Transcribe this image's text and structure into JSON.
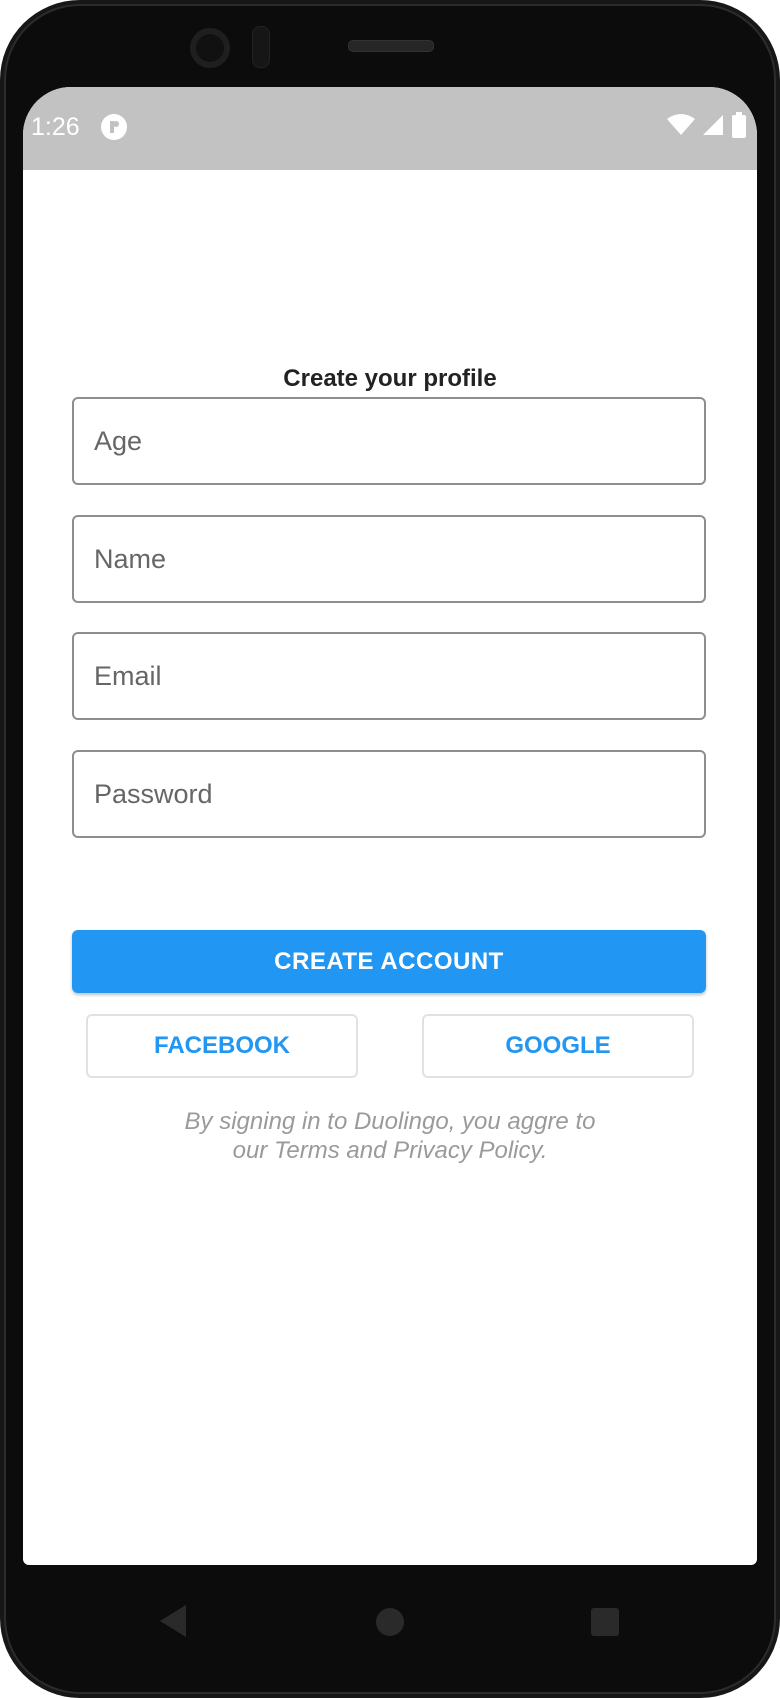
{
  "status_bar": {
    "time": "1:26"
  },
  "form": {
    "title": "Create your profile",
    "fields": [
      {
        "placeholder": "Age"
      },
      {
        "placeholder": "Name"
      },
      {
        "placeholder": "Email"
      },
      {
        "placeholder": "Password"
      }
    ],
    "create_button": "CREATE ACCOUNT",
    "facebook_button": "FACEBOOK",
    "google_button": "GOOGLE",
    "terms_line1": "By signing in to Duolingo, you aggre to",
    "terms_line2": "our Terms and Privacy Policy."
  },
  "colors": {
    "primary": "#2196f3",
    "status_bar": "#c2c2c2"
  },
  "icons": {
    "status": [
      "app-notification-icon",
      "wifi-icon",
      "signal-icon",
      "battery-icon"
    ],
    "nav": [
      "back-icon",
      "home-icon",
      "recents-icon"
    ]
  }
}
